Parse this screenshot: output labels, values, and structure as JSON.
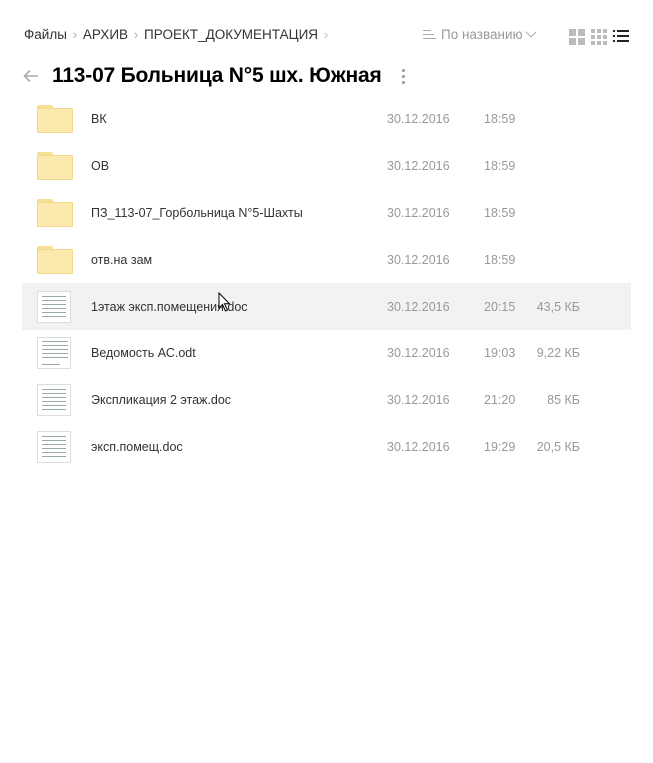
{
  "breadcrumb": [
    {
      "label": "Файлы"
    },
    {
      "label": "АРХИВ"
    },
    {
      "label": "ПРОЕКТ_ДОКУМЕНТАЦИЯ"
    }
  ],
  "sort": {
    "label": "По названию",
    "icon": "sort-icon"
  },
  "view_modes": [
    {
      "name": "large-tiles",
      "icon": "grid-large-icon",
      "active": false
    },
    {
      "name": "small-tiles",
      "icon": "grid-small-icon",
      "active": false
    },
    {
      "name": "list",
      "icon": "list-icon",
      "active": true
    }
  ],
  "folder": {
    "title": "113-07 Больница N°5 шх. Южная"
  },
  "files": [
    {
      "type": "folder",
      "name": "ВК",
      "date": "30.12.2016",
      "time": "18:59",
      "size": ""
    },
    {
      "type": "folder",
      "name": "ОВ",
      "date": "30.12.2016",
      "time": "18:59",
      "size": ""
    },
    {
      "type": "folder",
      "name": "ПЗ_113-07_Горбольница N°5-Шахты",
      "date": "30.12.2016",
      "time": "18:59",
      "size": ""
    },
    {
      "type": "folder",
      "name": "отв.на зам",
      "date": "30.12.2016",
      "time": "18:59",
      "size": ""
    },
    {
      "type": "document",
      "name": "1этаж эксп.помещения.doc",
      "date": "30.12.2016",
      "time": "20:15",
      "size": "43,5 КБ",
      "hovered": true
    },
    {
      "type": "document",
      "name": "Ведомость АС.odt",
      "date": "30.12.2016",
      "time": "19:03",
      "size": "9,22 КБ"
    },
    {
      "type": "document",
      "name": "Экспликация 2 этаж.doc",
      "date": "30.12.2016",
      "time": "21:20",
      "size": "85 КБ"
    },
    {
      "type": "document",
      "name": "эксп.помещ.doc",
      "date": "30.12.2016",
      "time": "19:29",
      "size": "20,5 КБ"
    }
  ],
  "colors": {
    "hover_row": "#f2f2f2",
    "folder_fill": "#fbe9ae",
    "muted_text": "#999999"
  }
}
